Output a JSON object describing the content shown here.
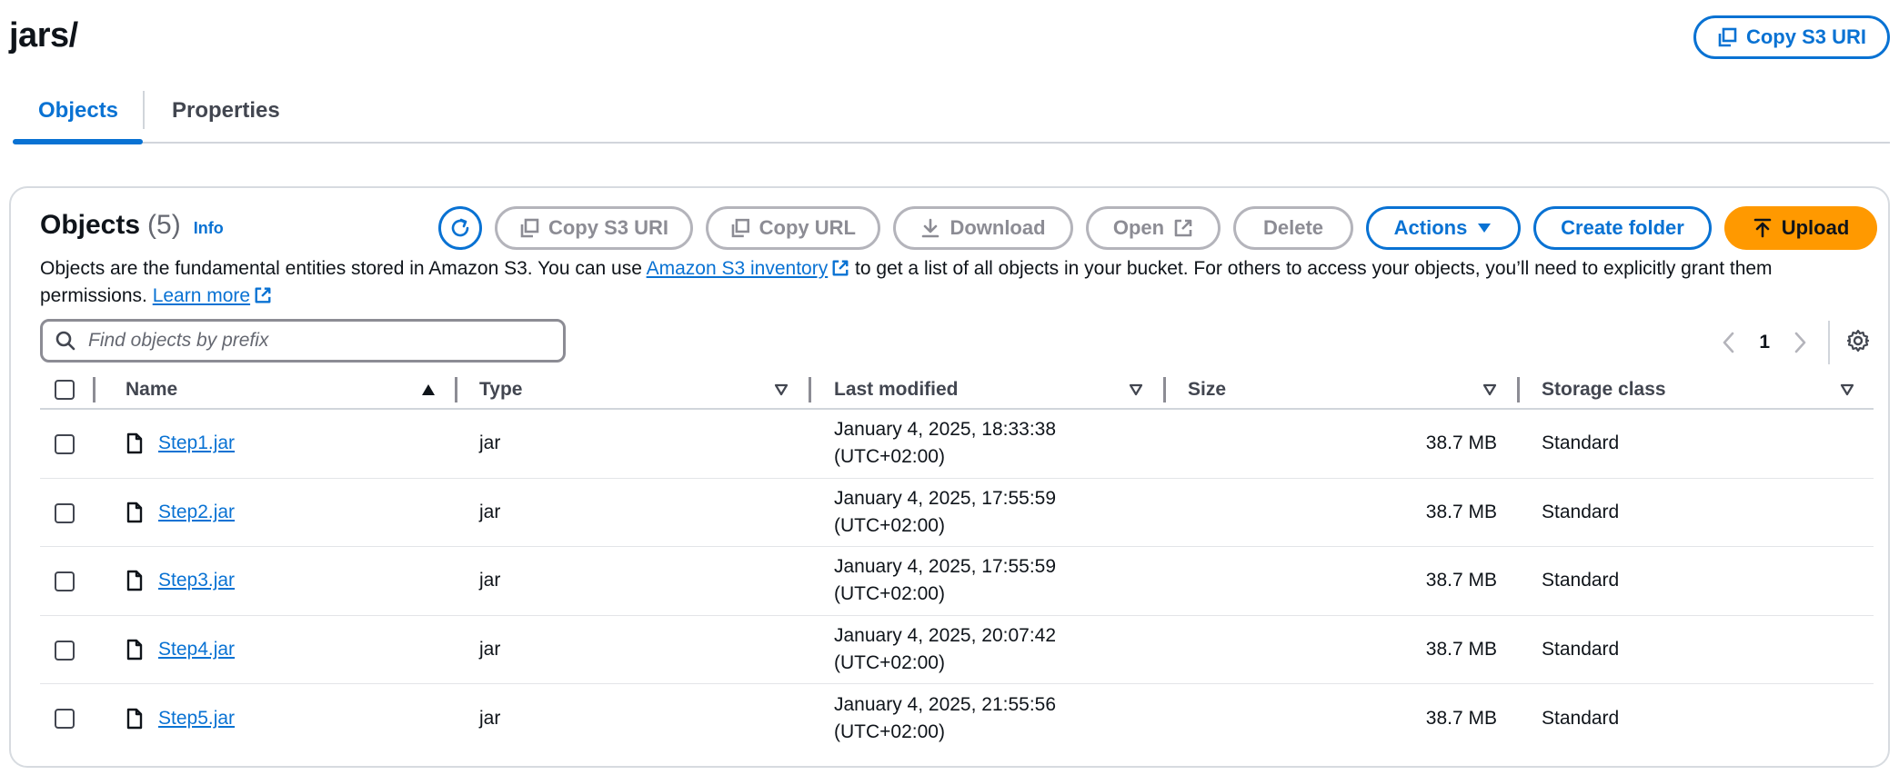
{
  "header": {
    "title": "jars/",
    "copy_s3_uri_label": "Copy S3 URI"
  },
  "tabs": [
    {
      "label": "Objects",
      "active": true
    },
    {
      "label": "Properties",
      "active": false
    }
  ],
  "objects_panel": {
    "heading": "Objects",
    "count": "(5)",
    "info_label": "Info",
    "toolbar": {
      "refresh_icon": "refresh-icon",
      "copy_s3_uri": "Copy S3 URI",
      "copy_url": "Copy URL",
      "download": "Download",
      "open": "Open",
      "delete": "Delete",
      "actions": "Actions",
      "create_folder": "Create folder",
      "upload": "Upload"
    },
    "description": {
      "part1": "Objects are the fundamental entities stored in Amazon S3. You can use ",
      "link1": "Amazon S3 inventory",
      "part2": " to get a list of all objects in your bucket. For others to access your objects, you’ll need to explicitly grant them permissions. ",
      "link2": "Learn more"
    },
    "search": {
      "placeholder": "Find objects by prefix",
      "value": ""
    },
    "pagination": {
      "current_page": "1"
    },
    "columns": [
      "Name",
      "Type",
      "Last modified",
      "Size",
      "Storage class"
    ],
    "rows": [
      {
        "name": "Step1.jar",
        "type": "jar",
        "modified_date": "January 4, 2025, 18:33:38",
        "modified_tz": "(UTC+02:00)",
        "size": "38.7 MB",
        "storage_class": "Standard"
      },
      {
        "name": "Step2.jar",
        "type": "jar",
        "modified_date": "January 4, 2025, 17:55:59",
        "modified_tz": "(UTC+02:00)",
        "size": "38.7 MB",
        "storage_class": "Standard"
      },
      {
        "name": "Step3.jar",
        "type": "jar",
        "modified_date": "January 4, 2025, 17:55:59",
        "modified_tz": "(UTC+02:00)",
        "size": "38.7 MB",
        "storage_class": "Standard"
      },
      {
        "name": "Step4.jar",
        "type": "jar",
        "modified_date": "January 4, 2025, 20:07:42",
        "modified_tz": "(UTC+02:00)",
        "size": "38.7 MB",
        "storage_class": "Standard"
      },
      {
        "name": "Step5.jar",
        "type": "jar",
        "modified_date": "January 4, 2025, 21:55:56",
        "modified_tz": "(UTC+02:00)",
        "size": "38.7 MB",
        "storage_class": "Standard"
      }
    ]
  },
  "colors": {
    "accent": "#0972d3",
    "upload": "#ff9900",
    "text": "#0f141a",
    "disabled": "#8c8c94"
  }
}
